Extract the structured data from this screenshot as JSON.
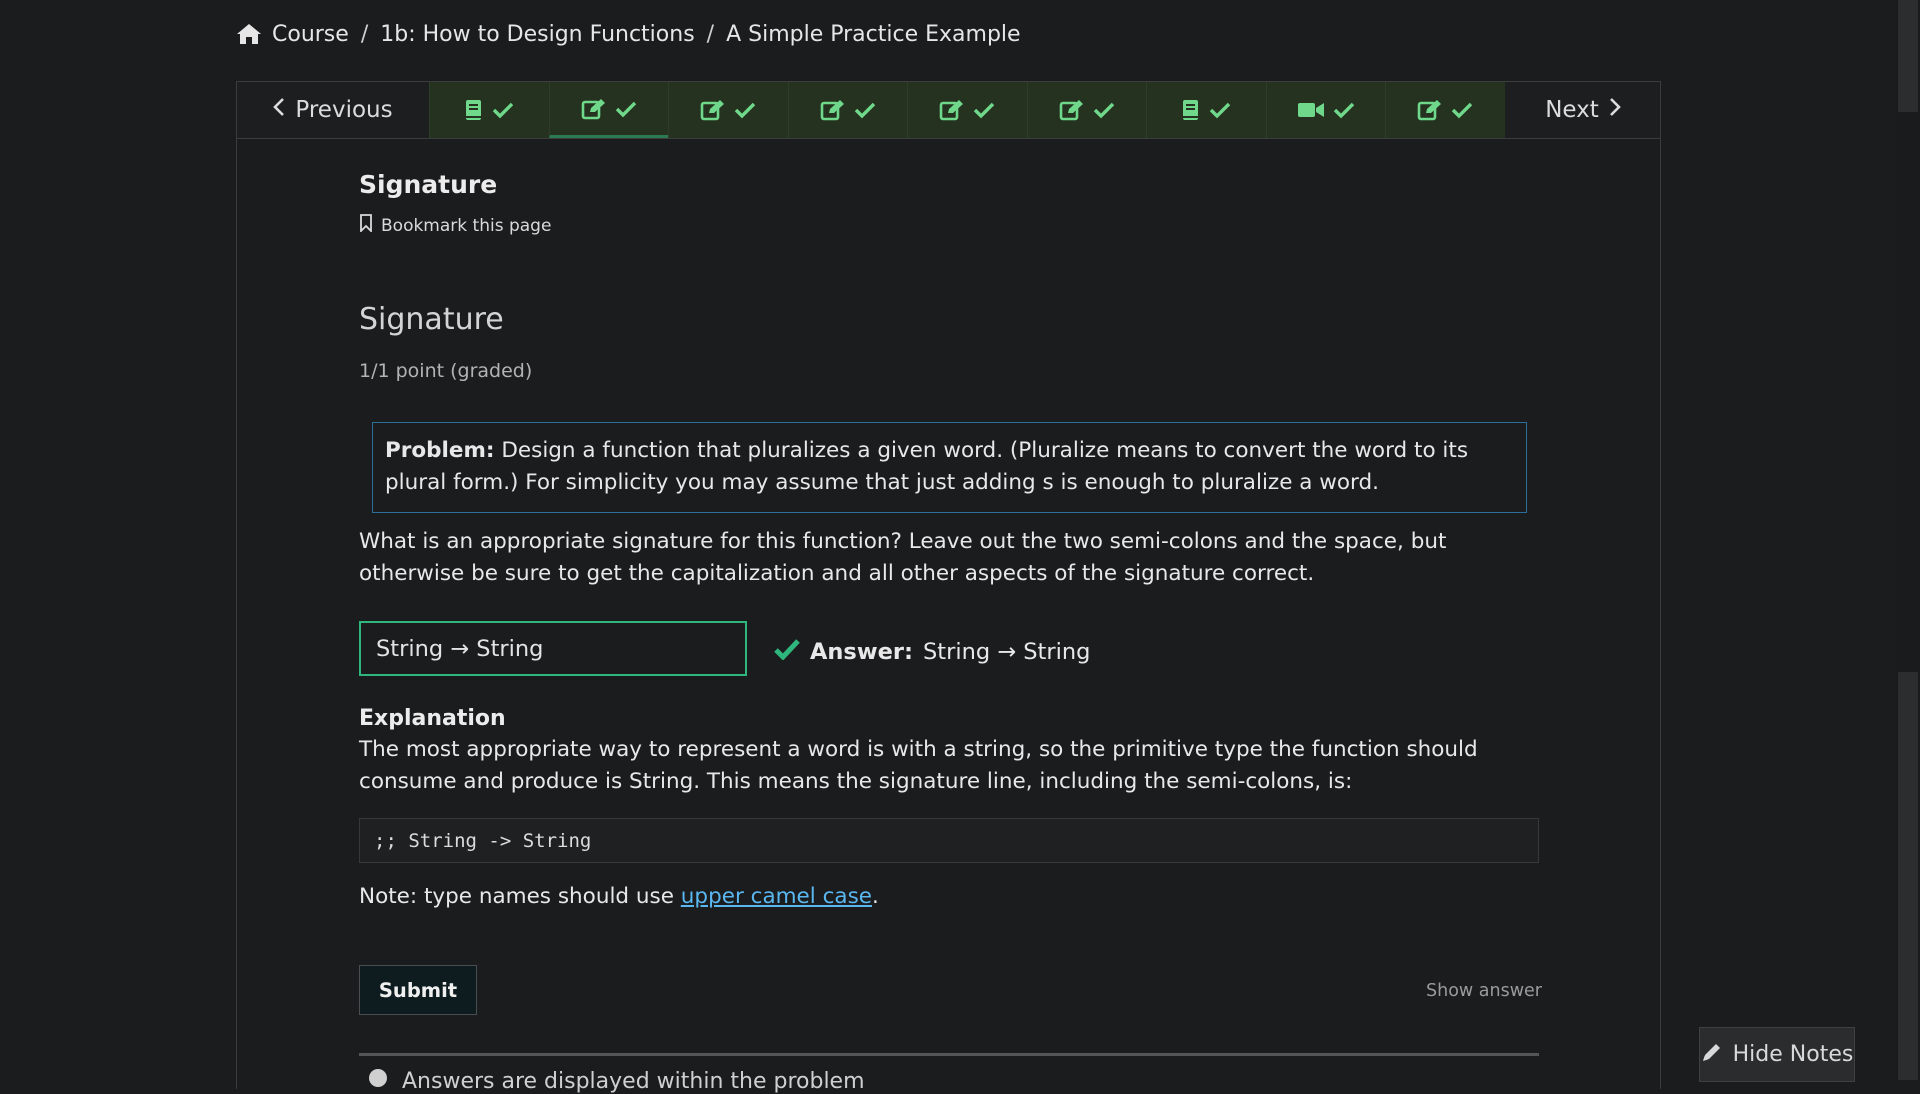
{
  "breadcrumb": {
    "home_icon": "home-icon",
    "items": [
      "Course",
      "1b: How to Design Functions",
      "A Simple Practice Example"
    ],
    "separator": "/"
  },
  "sequence_nav": {
    "previous_label": "Previous",
    "next_label": "Next",
    "tabs": [
      {
        "icon": "book-icon",
        "status": "check-icon"
      },
      {
        "icon": "edit-icon",
        "status": "check-icon",
        "active": true
      },
      {
        "icon": "edit-icon",
        "status": "check-icon"
      },
      {
        "icon": "edit-icon",
        "status": "check-icon"
      },
      {
        "icon": "edit-icon",
        "status": "check-icon"
      },
      {
        "icon": "edit-icon",
        "status": "check-icon"
      },
      {
        "icon": "book-icon",
        "status": "check-icon"
      },
      {
        "icon": "video-icon",
        "status": "check-icon"
      },
      {
        "icon": "edit-icon",
        "status": "check-icon"
      }
    ],
    "tab_color": "#24321f",
    "check_color": "#6fd88a"
  },
  "unit": {
    "title": "Signature",
    "bookmark_label": "Bookmark this page"
  },
  "problem": {
    "title": "Signature",
    "points": "1/1 point (graded)",
    "box_label": "Problem:",
    "box_text": "Design a function that pluralizes a given word. (Pluralize means to convert the word to its plural form.) For simplicity you may assume that just adding s is enough to pluralize a word.",
    "question": "What is an appropriate signature for this function? Leave out the two semi-colons and the space, but otherwise be sure to get the capitalization and all other aspects of the signature correct.",
    "input_value": "String → String",
    "answer_label": "Answer:",
    "answer_value": "String → String",
    "explanation_heading": "Explanation",
    "explanation_text": "The most appropriate way to represent a word is with a string, so the primitive type the function should consume and produce is String. This means the signature line, including the semi-colons, is:",
    "code": ";; String -> String",
    "note_prefix": "Note: type names should use ",
    "note_link": "upper camel case",
    "note_suffix": ".",
    "submit_label": "Submit",
    "show_answer_label": "Show answer",
    "notification_text": "Answers are displayed within the problem"
  },
  "hide_notes_label": "Hide Notes",
  "colors": {
    "background": "#1b1c1e",
    "correct_green": "#2eb67d",
    "link_blue": "#5ab7f0",
    "problem_border": "#2c6e9a"
  }
}
